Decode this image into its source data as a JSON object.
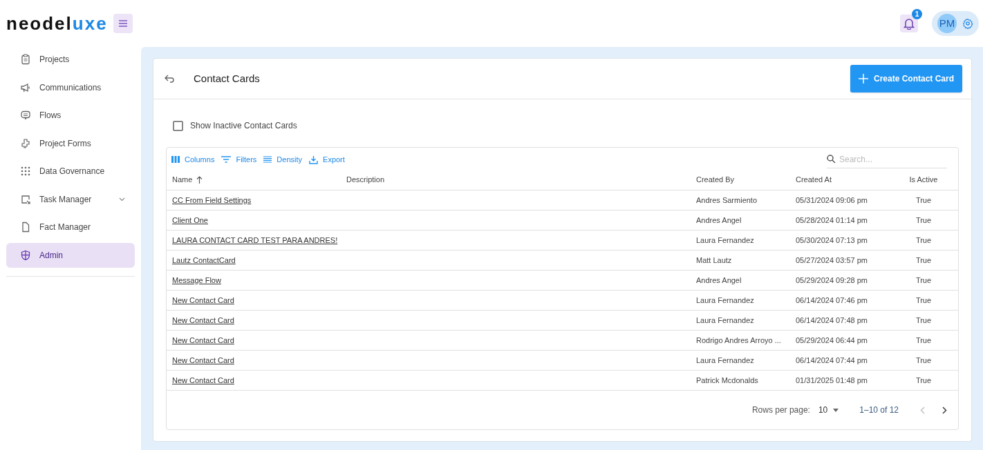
{
  "logo": {
    "part_1": "neodel",
    "part_2": "uxe"
  },
  "header": {
    "notifications": {
      "count": "1"
    },
    "avatar": "PM"
  },
  "sidebar": {
    "items": [
      {
        "label": "Projects",
        "selected": false,
        "expandable": false
      },
      {
        "label": "Communications",
        "selected": false,
        "expandable": false
      },
      {
        "label": "Flows",
        "selected": false,
        "expandable": false
      },
      {
        "label": "Project Forms",
        "selected": false,
        "expandable": false
      },
      {
        "label": "Data Governance",
        "selected": false,
        "expandable": false
      },
      {
        "label": "Task Manager",
        "selected": false,
        "expandable": true
      },
      {
        "label": "Fact Manager",
        "selected": false,
        "expandable": false
      },
      {
        "label": "Admin",
        "selected": true,
        "expandable": false
      }
    ]
  },
  "page": {
    "title": "Contact Cards",
    "create_button": "Create Contact Card",
    "show_inactive": {
      "label": "Show Inactive Contact Cards",
      "checked": false
    }
  },
  "toolbar": {
    "buttons": [
      {
        "label": "Columns"
      },
      {
        "label": "Filters"
      },
      {
        "label": "Density"
      },
      {
        "label": "Export"
      }
    ],
    "search": {
      "placeholder": "Search..."
    }
  },
  "table": {
    "columns": [
      {
        "label": "Name",
        "sorted": true
      },
      {
        "label": "Description",
        "sorted": false
      },
      {
        "label": "Created By",
        "sorted": false
      },
      {
        "label": "Created At",
        "sorted": false
      },
      {
        "label": "Is Active",
        "sorted": false
      }
    ],
    "rows": [
      [
        "CC From Field Settings",
        "",
        "Andres Sarmiento",
        "05/31/2024 09:06 pm",
        "True"
      ],
      [
        "Client One",
        "",
        "Andres Angel",
        "05/28/2024 01:14 pm",
        "True"
      ],
      [
        "LAURA CONTACT CARD TEST PARA ANDRES!",
        "",
        "Laura Fernandez",
        "05/30/2024 07:13 pm",
        "True"
      ],
      [
        "Lautz ContactCard",
        "",
        "Matt Lautz",
        "05/27/2024 03:57 pm",
        "True"
      ],
      [
        "Message Flow",
        "",
        "Andres Angel",
        "05/29/2024 09:28 pm",
        "True"
      ],
      [
        "New Contact Card",
        "",
        "Laura Fernandez",
        "06/14/2024 07:46 pm",
        "True"
      ],
      [
        "New Contact Card",
        "",
        "Laura Fernandez",
        "06/14/2024 07:48 pm",
        "True"
      ],
      [
        "New Contact Card",
        "",
        "Rodrigo Andres Arroyo ...",
        "05/29/2024 06:44 pm",
        "True"
      ],
      [
        "New Contact Card",
        "",
        "Laura Fernandez",
        "06/14/2024 07:44 pm",
        "True"
      ],
      [
        "New Contact Card",
        "",
        "Patrick Mcdonalds",
        "01/31/2025 01:48 pm",
        "True"
      ]
    ]
  },
  "pagination": {
    "rows_per_page_label": "Rows per page:",
    "rows_per_page": "10",
    "range": "1–10 of 12",
    "prev_disabled": true,
    "next_disabled": false
  }
}
